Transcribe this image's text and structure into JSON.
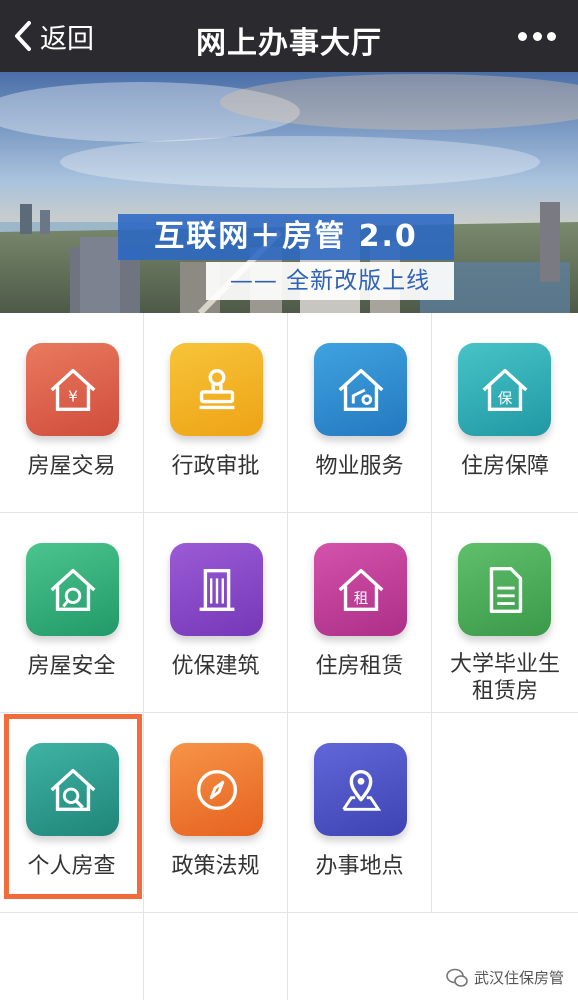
{
  "navbar": {
    "back_label": "返回",
    "title": "网上办事大厅"
  },
  "banner": {
    "title": "互联网＋房管 2.0",
    "subtitle": "—— 全新改版上线"
  },
  "menu": [
    {
      "label": "房屋交易",
      "icon": "house-yen-icon",
      "color": "#e0624a"
    },
    {
      "label": "行政审批",
      "icon": "stamp-icon",
      "color": "#f2b01e"
    },
    {
      "label": "物业服务",
      "icon": "house-service-icon",
      "color": "#2f8fd1"
    },
    {
      "label": "住房保障",
      "icon": "house-bao-icon",
      "color": "#2fb3b8"
    },
    {
      "label": "房屋安全",
      "icon": "house-safety-icon",
      "color": "#2fae7a"
    },
    {
      "label": "优保建筑",
      "icon": "building-icon",
      "color": "#8b49c9"
    },
    {
      "label": "住房租赁",
      "icon": "house-rent-icon",
      "color": "#c43f9a"
    },
    {
      "label": "大学毕业生租赁房",
      "label_line1": "大学毕业生",
      "label_line2": "租赁房",
      "icon": "document-icon",
      "color": "#4dac5a"
    },
    {
      "label": "个人房查",
      "icon": "house-search-icon",
      "color": "#2a9a8e"
    },
    {
      "label": "政策法规",
      "icon": "compass-icon",
      "color": "#ef7b35"
    },
    {
      "label": "办事地点",
      "icon": "location-map-icon",
      "color": "#4f55c9"
    }
  ],
  "watermark": "武汉住保房管"
}
